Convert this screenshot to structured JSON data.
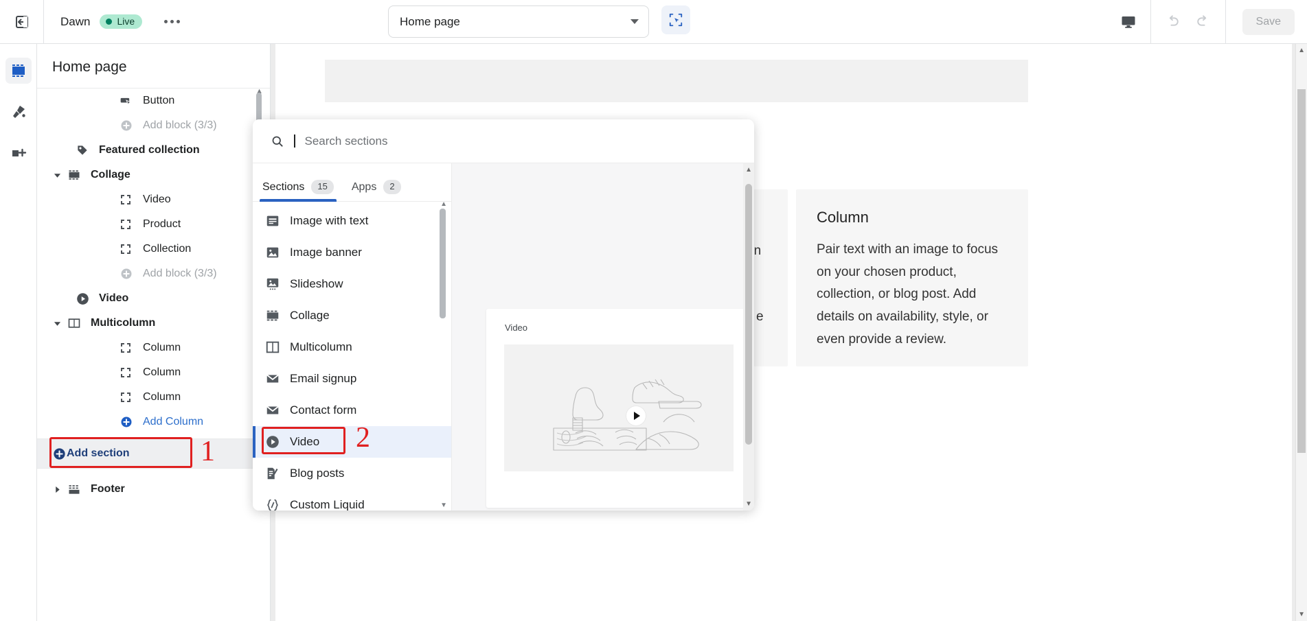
{
  "topbar": {
    "exit_icon": "exit-left-icon",
    "theme_name": "Dawn",
    "live_label": "Live",
    "more_icon": "more-horizontal-icon",
    "page_selector_value": "Home page",
    "select_tool_icon": "selection-pointer-icon",
    "device_icon": "desktop-icon",
    "undo_icon": "undo-icon",
    "redo_icon": "redo-icon",
    "save_label": "Save"
  },
  "rail": {
    "items": [
      {
        "name": "sections-icon",
        "label": "Sections",
        "active": true
      },
      {
        "name": "paintbrush-icon",
        "label": "Theme settings",
        "active": false
      },
      {
        "name": "app-blocks-icon",
        "label": "App embeds",
        "active": false
      }
    ]
  },
  "sidebar": {
    "title": "Home page",
    "tree": [
      {
        "label": "Button",
        "icon": "button-icon",
        "indent": "block",
        "state": "normal"
      },
      {
        "label": "Add block (3/3)",
        "icon": "plus-circle-icon",
        "indent": "block",
        "state": "muted"
      },
      {
        "label": "Featured collection",
        "icon": "tag-icon",
        "indent": "section",
        "state": "normal"
      },
      {
        "label": "Collage",
        "icon": "collage-icon",
        "indent": "section",
        "state": "normal",
        "caret": "down"
      },
      {
        "label": "Video",
        "icon": "block-frame-icon",
        "indent": "block",
        "state": "normal"
      },
      {
        "label": "Product",
        "icon": "block-frame-icon",
        "indent": "block",
        "state": "normal"
      },
      {
        "label": "Collection",
        "icon": "block-frame-icon",
        "indent": "block",
        "state": "normal"
      },
      {
        "label": "Add block (3/3)",
        "icon": "plus-circle-icon",
        "indent": "block",
        "state": "muted"
      },
      {
        "label": "Video",
        "icon": "play-circle-icon",
        "indent": "section",
        "state": "bold"
      },
      {
        "label": "Multicolumn",
        "icon": "multicolumn-icon",
        "indent": "section",
        "state": "bold",
        "caret": "down"
      },
      {
        "label": "Column",
        "icon": "block-frame-icon",
        "indent": "block",
        "state": "normal"
      },
      {
        "label": "Column",
        "icon": "block-frame-icon",
        "indent": "block",
        "state": "normal"
      },
      {
        "label": "Column",
        "icon": "block-frame-icon",
        "indent": "block",
        "state": "normal"
      },
      {
        "label": "Add Column",
        "icon": "plus-circle-blue-icon",
        "indent": "block",
        "state": "link"
      }
    ],
    "add_section_label": "Add section",
    "footer_label": "Footer"
  },
  "annotations": [
    {
      "number": "1",
      "target": "add-section-button"
    },
    {
      "number": "2",
      "target": "modal-video-item"
    }
  ],
  "modal": {
    "search_placeholder": "Search sections",
    "search_value": "",
    "search_icon": "search-icon",
    "tabs": [
      {
        "label": "Sections",
        "count": "15",
        "active": true
      },
      {
        "label": "Apps",
        "count": "2",
        "active": false
      }
    ],
    "items": [
      {
        "label": "Image with text",
        "icon": "image-with-text-icon",
        "selected": false
      },
      {
        "label": "Image banner",
        "icon": "image-icon",
        "selected": false
      },
      {
        "label": "Slideshow",
        "icon": "slideshow-icon",
        "selected": false
      },
      {
        "label": "Collage",
        "icon": "collage-icon",
        "selected": false
      },
      {
        "label": "Multicolumn",
        "icon": "multicolumn-icon",
        "selected": false
      },
      {
        "label": "Email signup",
        "icon": "envelope-icon",
        "selected": false
      },
      {
        "label": "Contact form",
        "icon": "envelope-icon",
        "selected": false
      },
      {
        "label": "Video",
        "icon": "play-circle-icon",
        "selected": true
      },
      {
        "label": "Blog posts",
        "icon": "blog-posts-icon",
        "selected": false
      },
      {
        "label": "Custom Liquid",
        "icon": "custom-liquid-icon",
        "selected": false
      }
    ],
    "preview": {
      "label": "Video",
      "play_icon": "play-icon",
      "media_alt": "shoes-illustration"
    }
  },
  "preview_pane": {
    "column_title": "Column",
    "column_text": "Pair text with an image to focus on your chosen product, collection, or blog post. Add details on availability, style, or even provide a review.",
    "partial_text_1": "on",
    "partial_text_2": "e"
  }
}
